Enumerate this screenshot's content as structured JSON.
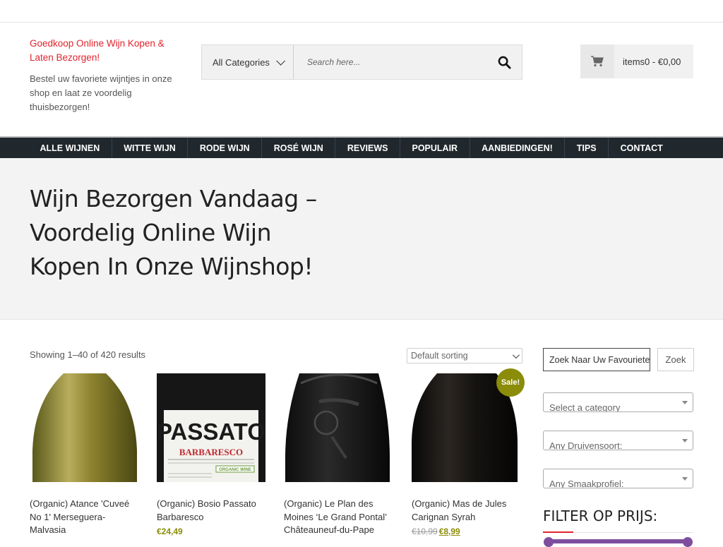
{
  "brand": {
    "title": "Goedkoop Online Wijn Kopen & Laten Bezorgen!",
    "tagline": "Bestel uw favoriete wijntjes in onze shop en laat ze voordelig thuisbezorgen!"
  },
  "search": {
    "category_label": "All Categories",
    "placeholder": "Search here..."
  },
  "cart": {
    "label": "items0 - €0,00"
  },
  "nav": {
    "items": [
      "ALLE WIJNEN",
      "WITTE WIJN",
      "RODE WIJN",
      "ROSÉ WIJN",
      "REVIEWS",
      "POPULAIR",
      "AANBIEDINGEN!",
      "TIPS",
      "CONTACT"
    ]
  },
  "hero": {
    "title": "Wijn Bezorgen Vandaag – Voordelig Online Wijn Kopen In Onze Wijnshop!"
  },
  "shop": {
    "result_count": "Showing 1–40 of 420 results",
    "sorting": "Default sorting",
    "sale_badge": "Sale!",
    "products": [
      {
        "title": "(Organic) Atance 'Cuveé No 1' Merseguera-Malvasia",
        "price": ""
      },
      {
        "title": "(Organic) Bosio Passato Barbaresco",
        "price": "€24,49"
      },
      {
        "title": "(Organic) Le Plan des Moines ‘Le Grand Pontal’ Châteauneuf-du-Pape",
        "price": ""
      },
      {
        "title": "(Organic) Mas de Jules Carignan Syrah",
        "old_price": "€10,99",
        "price": "€8,99"
      }
    ],
    "label_passato": "PASSATO",
    "label_barbaresco": "BARBARESCO",
    "label_organic": "ORGANIC WINE"
  },
  "sidebar": {
    "search_value": "Zoek Naar Uw Favouriete Wijn",
    "search_button": "Zoek",
    "select_category": "Select a category",
    "select_grape": "Any Druivensoort:",
    "select_taste": "Any Smaakprofiel:",
    "filter_title": "FILTER OP PRIJS:"
  },
  "colors": {
    "brand_red": "#e0242d",
    "nav_bg": "#20282d",
    "price_olive": "#8b8c09",
    "slider_purple": "#7e4e9e"
  }
}
